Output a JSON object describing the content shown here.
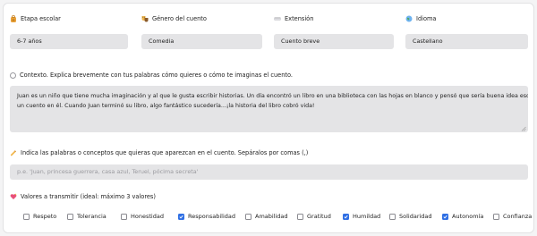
{
  "fields": {
    "etapa": {
      "label": "Etapa escolar",
      "value": "6-7 años",
      "icon": "backpack-icon"
    },
    "genero": {
      "label": "Género del cuento",
      "value": "Comedia",
      "icon": "theater-masks-icon"
    },
    "extension": {
      "label": "Extensión",
      "value": "Cuento breve",
      "icon": "ruler-icon"
    },
    "idioma": {
      "label": "Idioma",
      "value": "Castellano",
      "icon": "globe-icon"
    }
  },
  "context": {
    "label": "Contexto. Explica brevemente con tus palabras cómo quieres o cómo te imaginas el cuento.",
    "text_line1": "Juan es un niño que tiene mucha imaginación y al que le gusta escribir historias. Un día encontró un libro en una biblioteca con las hojas en blanco y pensó que sería buena idea escribir",
    "text_line2": "un cuento en él. Cuando Juan terminó su libro, algo fantástico sucedería...¡la historia del libro cobró vida!"
  },
  "keywords": {
    "label": "Indica las palabras o conceptos que quieras que aparezcan en el cuento. Sepáralos por comas (,)",
    "placeholder": "p.e. 'Juan, princesa guerrera, casa azul, Teruel, pócima secreta'",
    "icon": "writing-hand-icon"
  },
  "valores": {
    "label": "Valores a transmitir (ideal: máximo 3 valores)",
    "icon": "heart-icon",
    "items": [
      {
        "label": "Respeto",
        "checked": false
      },
      {
        "label": "Tolerancia",
        "checked": false
      },
      {
        "label": "Honestidad",
        "checked": false
      },
      {
        "label": "Responsabilidad",
        "checked": true
      },
      {
        "label": "Amabilidad",
        "checked": false
      },
      {
        "label": "Gratitud",
        "checked": false
      },
      {
        "label": "Humildad",
        "checked": true
      },
      {
        "label": "Solidaridad",
        "checked": false
      },
      {
        "label": "Autonomía",
        "checked": true
      },
      {
        "label": "Confianza",
        "checked": false
      }
    ]
  },
  "colors": {
    "accent": "#2f6fe4",
    "field_bg": "#e4e4e6",
    "page_bg": "#f4f4f5"
  }
}
